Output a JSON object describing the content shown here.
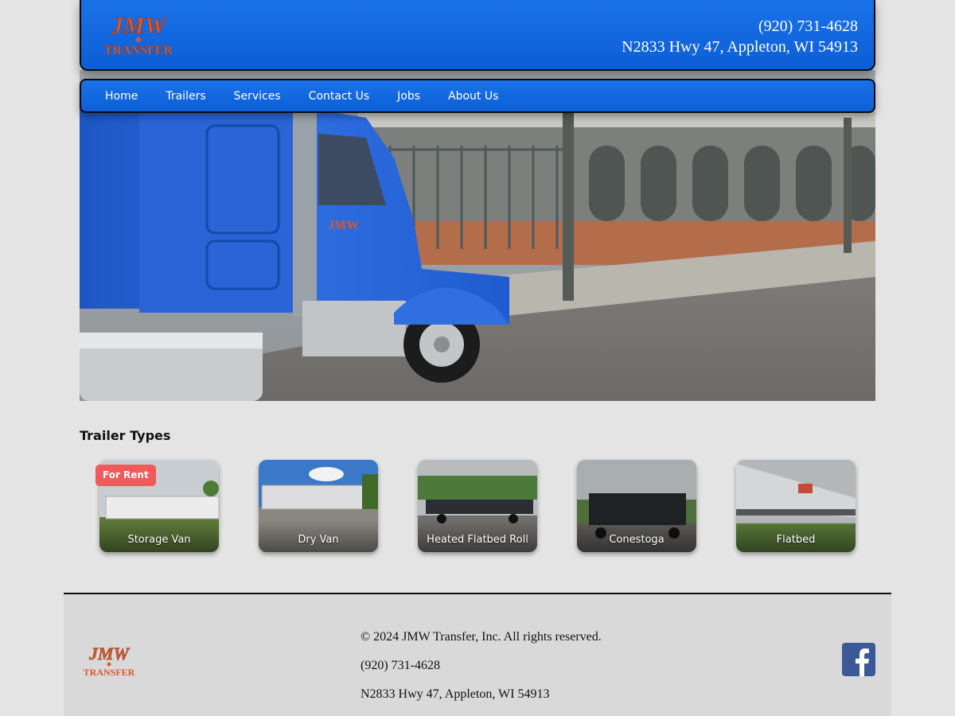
{
  "brand": {
    "logo_text_top": "JMW",
    "logo_text_bottom": "TRANSFER",
    "logo_color": "#d9572f"
  },
  "header": {
    "phone": "(920) 731-4628",
    "address": "N2833 Hwy 47, Appleton, WI 54913"
  },
  "nav": {
    "items": [
      "Home",
      "Trailers",
      "Services",
      "Contact Us",
      "Jobs",
      "About Us"
    ]
  },
  "trailers": {
    "title": "Trailer Types",
    "badge": "For Rent",
    "cards": [
      "Storage Van",
      "Dry Van",
      "Heated Flatbed Roll",
      "Conestoga",
      "Flatbed"
    ]
  },
  "footer": {
    "copyright": "© 2024 JMW Transfer, Inc. All rights reserved.",
    "phone": "(920) 731-4628",
    "address": "N2833 Hwy 47, Appleton, WI 54913",
    "social_icon": "facebook-icon"
  },
  "colors": {
    "primary": "#1567e0",
    "badge": "#f05a5a",
    "facebook": "#3b5998"
  }
}
